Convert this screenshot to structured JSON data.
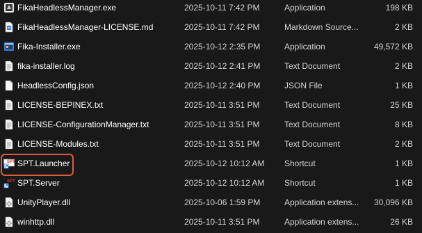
{
  "files": [
    {
      "name": "FikaHeadlessManager.exe",
      "date": "2025-10-11 7:42 PM",
      "type": "Application",
      "size": "198 KB",
      "icon": "exe-icon"
    },
    {
      "name": "FikaHeadlessManager-LICENSE.md",
      "date": "2025-10-11 7:42 PM",
      "type": "Markdown Source...",
      "size": "2 KB",
      "icon": "markdown-file-icon"
    },
    {
      "name": "Fika-Installer.exe",
      "date": "2025-10-12 2:35 PM",
      "type": "Application",
      "size": "49,572 KB",
      "icon": "installer-icon"
    },
    {
      "name": "fika-installer.log",
      "date": "2025-10-12 2:41 PM",
      "type": "Text Document",
      "size": "2 KB",
      "icon": "text-file-icon"
    },
    {
      "name": "HeadlessConfig.json",
      "date": "2025-10-12 2:40 PM",
      "type": "JSON File",
      "size": "1 KB",
      "icon": "json-file-icon"
    },
    {
      "name": "LICENSE-BEPINEX.txt",
      "date": "2025-10-11 3:51 PM",
      "type": "Text Document",
      "size": "25 KB",
      "icon": "text-file-icon"
    },
    {
      "name": "LICENSE-ConfigurationManager.txt",
      "date": "2025-10-11 3:51 PM",
      "type": "Text Document",
      "size": "8 KB",
      "icon": "text-file-icon"
    },
    {
      "name": "LICENSE-Modules.txt",
      "date": "2025-10-11 3:51 PM",
      "type": "Text Document",
      "size": "2 KB",
      "icon": "text-file-icon"
    },
    {
      "name": "SPT.Launcher",
      "date": "2025-10-12 10:12 AM",
      "type": "Shortcut",
      "size": "1 KB",
      "icon": "spt-shortcut-icon"
    },
    {
      "name": "SPT.Server",
      "date": "2025-10-12 10:12 AM",
      "type": "Shortcut",
      "size": "1 KB",
      "icon": "spt-shortcut-icon"
    },
    {
      "name": "UnityPlayer.dll",
      "date": "2025-10-06 1:59 PM",
      "type": "Application extens...",
      "size": "30,096 KB",
      "icon": "dll-file-icon"
    },
    {
      "name": "winhttp.dll",
      "date": "2025-10-11 3:51 PM",
      "type": "Application extens...",
      "size": "26 KB",
      "icon": "dll-file-icon"
    }
  ],
  "badges": {
    "spt_text": "SPT"
  },
  "colors": {
    "background": "#191919",
    "highlight_border": "#e05a3f",
    "spt_badge": "#e03030"
  }
}
